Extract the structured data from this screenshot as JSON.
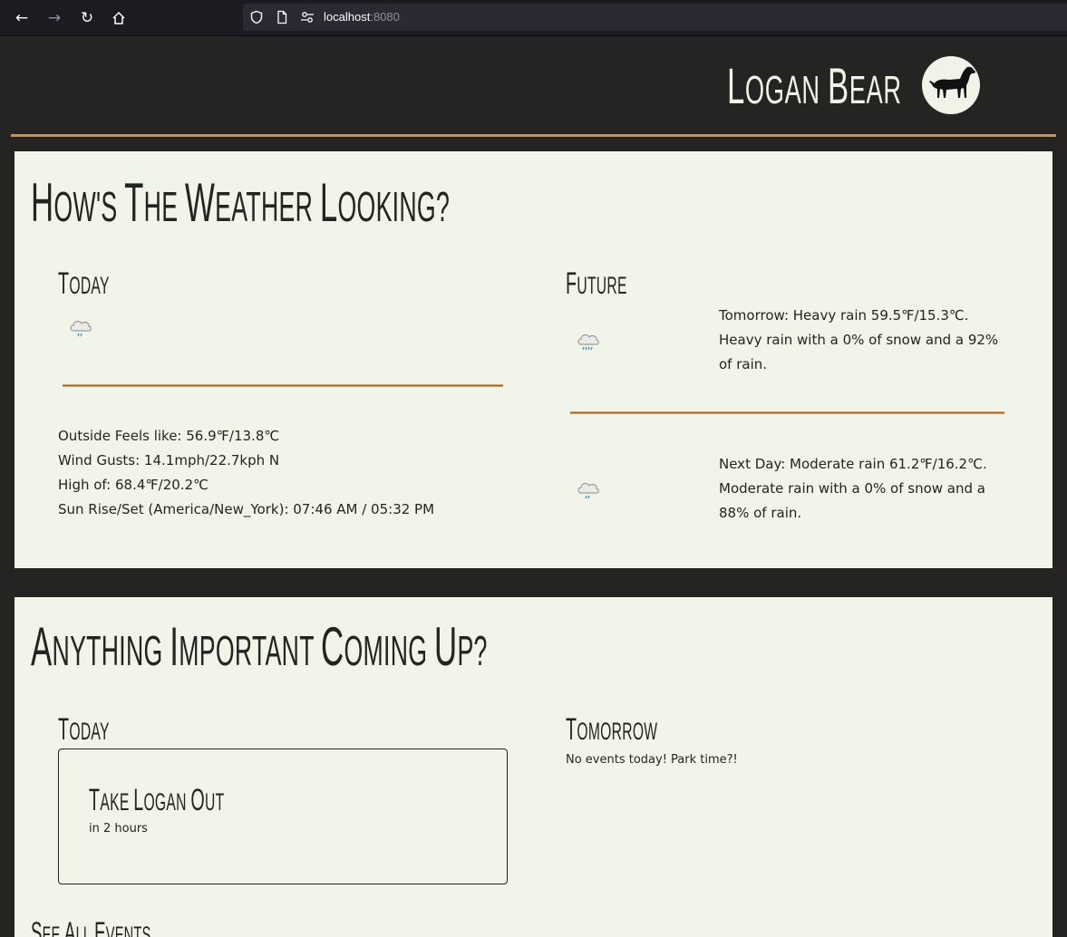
{
  "browser": {
    "url_host": "localhost",
    "url_port": ":8080"
  },
  "header": {
    "brand_first": "L",
    "brand_rest_1": "OGAN ",
    "brand_second": "B",
    "brand_rest_2": "EAR"
  },
  "weather": {
    "title_parts": [
      "H",
      "OW'S ",
      "T",
      "HE ",
      "W",
      "EATHER ",
      "L",
      "OOKING?"
    ],
    "today": {
      "heading_first": "T",
      "heading_rest": "ODAY",
      "icon": "rain-cloud-icon",
      "feels_like": "Outside Feels like: 56.9℉/13.8℃",
      "wind_gusts": "Wind Gusts: 14.1mph/22.7kph N",
      "high": "High of: 68.4℉/20.2℃",
      "sun": "Sun Rise/Set (America/New_York): 07:46 AM / 05:32 PM"
    },
    "future": {
      "heading_first": "F",
      "heading_rest": "UTURE",
      "days": [
        {
          "icon": "heavy-rain-cloud-icon",
          "text": "Tomorrow: Heavy rain 59.5℉/15.3℃. Heavy rain with a 0% of snow and a 92% of rain."
        },
        {
          "icon": "moderate-rain-cloud-icon",
          "text": "Next Day: Moderate rain 61.2℉/16.2℃. Moderate rain with a 0% of snow and a 88% of rain."
        }
      ]
    }
  },
  "events": {
    "title_parts": [
      "A",
      "NYTHING ",
      "I",
      "MPORTANT ",
      "C",
      "OMING ",
      "U",
      "P?"
    ],
    "today": {
      "heading_first": "T",
      "heading_rest": "ODAY",
      "card_parts": [
        "T",
        "AKE ",
        "L",
        "OGAN ",
        "O",
        "UT"
      ],
      "card_when": "in 2 hours"
    },
    "tomorrow": {
      "heading_first": "T",
      "heading_rest": "OMORROW",
      "empty": "No events today! Park time?!"
    },
    "see_all_parts": [
      "S",
      "EE ",
      "A",
      "LL ",
      "E",
      "VENTS"
    ]
  }
}
